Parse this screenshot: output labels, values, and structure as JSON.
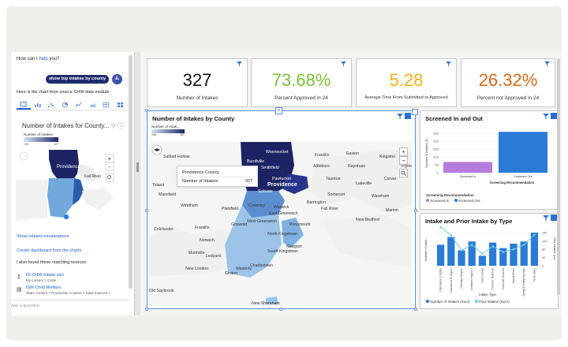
{
  "assistant": {
    "question_prefix": "How can I",
    "question_link": "help",
    "question_suffix": "you?",
    "user_chip": "show top intakes by county",
    "user_initials": "JL",
    "source_text": "Here is the chart from source CHW data module:",
    "mini_chart_title": "Number of Intakes for County...",
    "mini_legend_title": "Number of Intakes",
    "mini_legend_min": "136",
    "mini_legend_max": "327",
    "mini_map_label_a": "Providence",
    "mini_map_label_b": "Fall River",
    "link_related": "Show related visualizations",
    "link_create": "Create dashboard from the charts",
    "sources_heading": "I also found these matching sources:",
    "source1_name": "RI-CHW-Intake.xlsx",
    "source1_path": "My content > CHW",
    "source2_name": "ISM Child Welfare",
    "source2_path": "Team content > Production Content > Data Sources >",
    "ask_placeholder": "Ask a question"
  },
  "kpis": [
    {
      "value": "327",
      "label": "Number of Intakes",
      "color": "#111111"
    },
    {
      "value": "73.68%",
      "label": "Percent Approved in 24",
      "color": "#7cbf3c"
    },
    {
      "value": "5.28",
      "label": "Average Time From Submitted to Approved",
      "color": "#f0b419"
    },
    {
      "value": "26.32%",
      "label": "Percent not Approved in 24",
      "color": "#d2691e"
    }
  ],
  "map_panel": {
    "title": "Number of Intakes by County",
    "legend_title": "Number of Intak...",
    "legend_min": "136",
    "legend_max": "327",
    "tooltip_title": "Providence County",
    "tooltip_key": "Number of Intakes:",
    "tooltip_value": "327",
    "places": [
      "Woonsocket",
      "Franklin",
      "Easton",
      "Kingston",
      "Plymou",
      "Salford Hollow",
      "Putnam",
      "Burrillville",
      "Smithfield",
      "Attleboro",
      "Raynham",
      "Carver",
      "Toland",
      "Providence",
      "Pawtucket",
      "Taunton",
      "Lakeville",
      "Mansfield",
      "Scituate",
      "Barrington",
      "Somerset",
      "Wareham",
      "Windham",
      "Plainfield",
      "Coventry",
      "Warwick",
      "Fall River",
      "Marion",
      "East Greenwich",
      "New Bedford",
      "West Greenwich",
      "Colchester",
      "Franklin",
      "Griswold",
      "Portsmouth",
      "Norwich",
      "North Kingstown",
      "Montville",
      "Ledyard",
      "South Kingstown",
      "Newport",
      "New London",
      "Westerly",
      "Charlestown",
      "Groton",
      "Old Saybrook",
      "New Shoreham"
    ]
  },
  "screened_panel": {
    "title": "Screened In and Out",
    "y_label": "Number of Intakes (S...",
    "x_label": "Screening Recommendation",
    "legend_title": "Screening Recommendation",
    "legend": [
      "Screened In",
      "Screened Out"
    ],
    "colors": {
      "screened_in": "#b57bdf",
      "screened_out": "#2a7bd6"
    }
  },
  "type_panel": {
    "title": "Intake and Prior Intake by Type",
    "y_left": "Number of Intak...",
    "y_right": "Prior Intakes (Su...",
    "x_label": "Intake Type",
    "legend": [
      "Number of Intakes (Sum)",
      "Prior Intakes (Sum)"
    ],
    "colors": {
      "bars": "#2a7bd6",
      "line": "#6fd0e8"
    }
  },
  "chart_data": [
    {
      "type": "bar",
      "title": "Screened In and Out",
      "categories": [
        "Screened In",
        "Screened Out"
      ],
      "values": [
        68,
        259
      ],
      "xlabel": "Screening Recommendation",
      "ylabel": "Number of Intakes (S...",
      "yticks": [
        0,
        50,
        100,
        150,
        200,
        250
      ],
      "ylim": [
        0,
        260
      ]
    },
    {
      "type": "bar",
      "title": "Intake and Prior Intake by Type",
      "categories": [
        "Child Waive of Rights",
        "Child Abuse & Neglect",
        "Caretaker Neglect",
        "Caretaker Neglect 2",
        "Non-Custody",
        "Domestic Relations",
        "Protective Services",
        "Sexual Abuse",
        "Safety & Family Earnings",
        "North Idaho"
      ],
      "series": [
        {
          "name": "Number of Intakes (Sum)",
          "values": [
            38,
            52,
            28,
            44,
            18,
            42,
            32,
            40,
            44,
            60
          ]
        },
        {
          "name": "Prior Intakes (Sum)",
          "values": [
            70,
            55,
            28,
            38,
            22,
            35,
            25,
            30,
            38,
            56
          ]
        }
      ],
      "xlabel": "Intake Type",
      "ylim": [
        0,
        60
      ],
      "y2ticks": [
        0,
        40,
        80,
        120,
        160
      ]
    }
  ]
}
